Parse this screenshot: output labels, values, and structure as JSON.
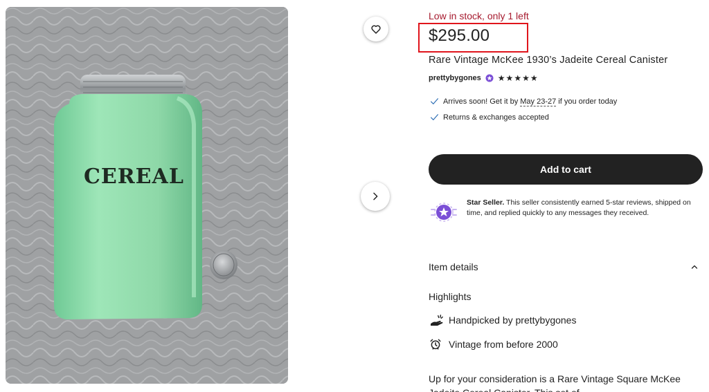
{
  "stock": {
    "message": "Low in stock, only 1 left"
  },
  "product": {
    "price": "$295.00",
    "title": "Rare Vintage McKee 1930’s Jadeite Cereal Canister",
    "label_on_jar": "CEREAL"
  },
  "seller": {
    "name": "prettybygones",
    "stars": "★★★★★",
    "rating": 5
  },
  "perks": {
    "arrival_prefix": "Arrives soon! Get it by ",
    "arrival_dates": "May 23-27",
    "arrival_suffix": " if you order today",
    "returns": "Returns & exchanges accepted"
  },
  "cart": {
    "label": "Add to cart"
  },
  "star_seller": {
    "title": "Star Seller.",
    "text": " This seller consistently earned 5-star reviews, shipped on time, and replied quickly to any messages they received."
  },
  "details": {
    "section_label": "Item details",
    "highlights_label": "Highlights",
    "handpicked_prefix": "Handpicked by ",
    "handpicked_seller": "prettybygones",
    "vintage": "Vintage from before 2000",
    "description": "Up for your consideration is a Rare Vintage Square McKee Jadeite Cereal Canister. This set of ... "
  },
  "icons": {
    "favorite": "heart-icon",
    "next": "chevron-right-icon",
    "check": "check-icon",
    "collapse": "chevron-up-icon",
    "handpicked": "hand-icon",
    "vintage": "alarm-clock-icon",
    "star_seller": "star-seller-badge-icon"
  },
  "colors": {
    "stock_text": "#a61a2e",
    "highlight_box": "#e0141b",
    "cart_button": "#222222",
    "star_seller_purple": "#7b4fd6",
    "jadeite_green": "#8ed8a8"
  }
}
